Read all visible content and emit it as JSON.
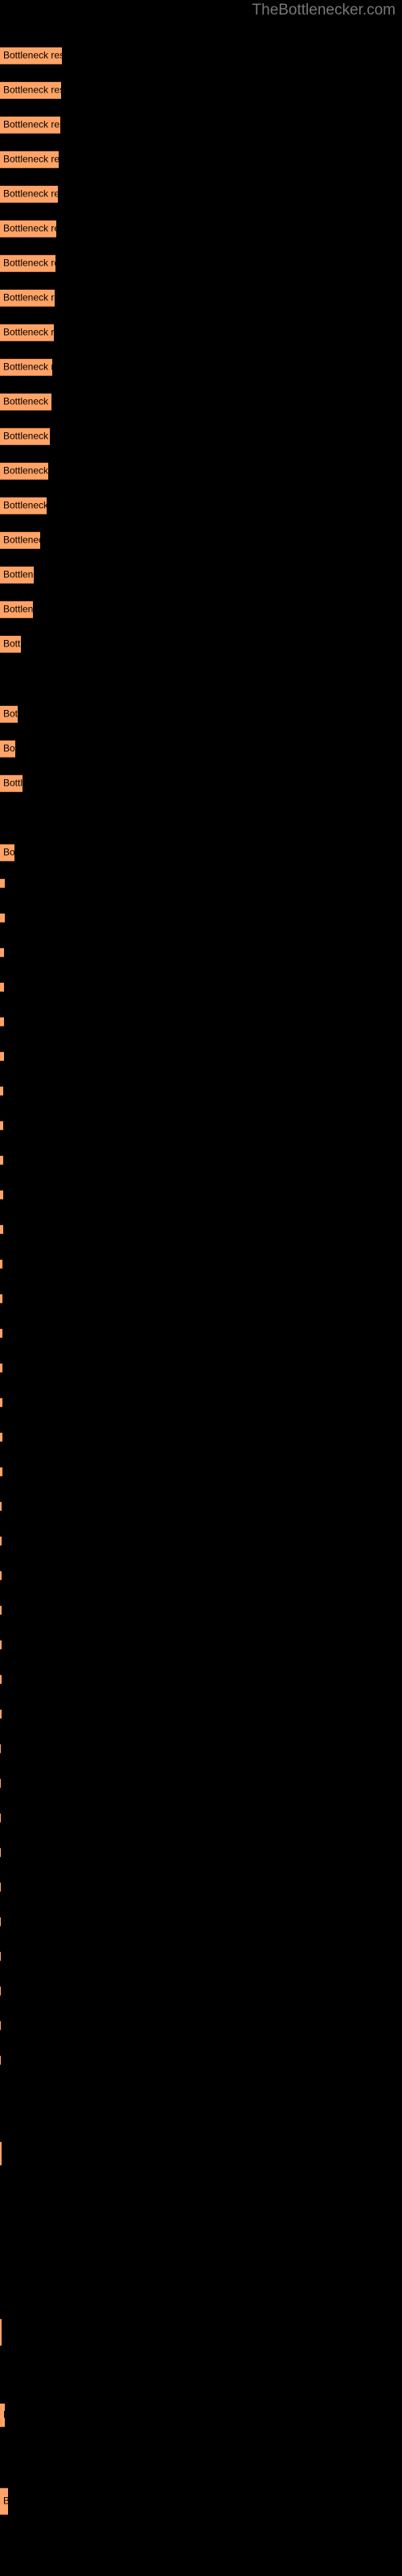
{
  "watermark": "TheBottlenecker.com",
  "theme": {
    "background": "#000000",
    "bar_color": "#ffa366",
    "bar_label_color": "#000000",
    "watermark_color": "#787878"
  },
  "chart_data": {
    "type": "bar",
    "orientation": "horizontal",
    "title": "",
    "subtitle": "",
    "xlabel": "",
    "ylabel": "",
    "grid": false,
    "legend": null,
    "axis_visible": false,
    "tick_labels_visible": false,
    "bar_label_text": "Bottleneck result",
    "xlim": [
      0,
      100
    ],
    "categories": [
      "bar-1",
      "bar-2",
      "bar-3",
      "bar-4",
      "bar-5",
      "bar-6",
      "bar-7",
      "bar-8",
      "bar-9",
      "bar-10",
      "bar-11",
      "bar-12",
      "bar-13",
      "bar-14",
      "bar-15",
      "bar-16",
      "bar-17",
      "bar-18",
      "bar-19",
      "bar-20",
      "bar-21",
      "bar-22",
      "bar-23",
      "bar-24",
      "bar-25",
      "bar-26",
      "bar-27",
      "bar-28",
      "bar-29",
      "bar-30",
      "bar-31",
      "bar-32",
      "bar-33",
      "bar-34",
      "bar-35",
      "bar-36",
      "bar-37",
      "bar-38",
      "bar-39",
      "bar-40",
      "bar-41",
      "bar-42",
      "bar-43",
      "bar-44",
      "bar-45",
      "bar-46",
      "bar-47",
      "bar-48",
      "bar-49",
      "bar-50",
      "bar-51",
      "bar-52",
      "bar-53",
      "bar-54",
      "bar-55",
      "bar-56",
      "bar-57",
      "bar-58",
      "bar-59",
      "bar-60",
      "bar-61",
      "bar-62",
      "bar-63",
      "bar-64",
      "bar-65",
      "bar-66",
      "bar-67",
      "bar-68",
      "bar-69",
      "bar-70",
      "bar-71",
      "bar-72",
      "bar-73"
    ],
    "values": [
      77,
      76,
      75,
      73,
      72,
      70,
      69,
      68,
      67,
      65,
      64,
      62,
      60,
      58,
      50,
      42,
      41,
      26,
      22,
      19,
      18,
      17,
      16,
      15,
      14,
      13,
      13,
      12,
      12,
      11,
      11,
      10,
      10,
      9,
      9,
      9,
      8,
      8,
      8,
      7,
      7,
      7,
      6,
      6,
      6,
      6,
      5,
      5,
      5,
      5,
      5,
      4,
      4,
      4,
      4,
      4,
      4,
      3,
      3,
      3,
      3,
      3,
      3,
      3,
      2,
      2,
      2,
      2,
      1,
      1,
      5,
      10,
      19
    ],
    "bars": [
      {
        "name": "bar-1",
        "y": 58,
        "height": 22,
        "width": 77,
        "label": "Bottleneck result"
      },
      {
        "name": "bar-2",
        "y": 101,
        "height": 22,
        "width": 76,
        "label": "Bottleneck result"
      },
      {
        "name": "bar-3",
        "y": 144,
        "height": 22,
        "width": 75,
        "label": "Bottleneck result"
      },
      {
        "name": "bar-4",
        "y": 187,
        "height": 22,
        "width": 73,
        "label": "Bottleneck result"
      },
      {
        "name": "bar-5",
        "y": 230,
        "height": 22,
        "width": 72,
        "label": "Bottleneck result"
      },
      {
        "name": "bar-6",
        "y": 273,
        "height": 22,
        "width": 70,
        "label": "Bottleneck result"
      },
      {
        "name": "bar-7",
        "y": 316,
        "height": 22,
        "width": 69,
        "label": "Bottleneck result"
      },
      {
        "name": "bar-8",
        "y": 359,
        "height": 22,
        "width": 68,
        "label": "Bottleneck result"
      },
      {
        "name": "bar-9",
        "y": 402,
        "height": 22,
        "width": 67,
        "label": "Bottleneck result"
      },
      {
        "name": "bar-10",
        "y": 445,
        "height": 22,
        "width": 65,
        "label": "Bottleneck result"
      },
      {
        "name": "bar-11",
        "y": 488,
        "height": 22,
        "width": 64,
        "label": "Bottleneck result"
      },
      {
        "name": "bar-12",
        "y": 531,
        "height": 22,
        "width": 62,
        "label": "Bottleneck result"
      },
      {
        "name": "bar-13",
        "y": 574,
        "height": 22,
        "width": 60,
        "label": "Bottleneck result"
      },
      {
        "name": "bar-14",
        "y": 617,
        "height": 22,
        "width": 58,
        "label": "Bottleneck result"
      },
      {
        "name": "bar-15",
        "y": 660,
        "height": 22,
        "width": 50,
        "label": "Bottleneck result"
      },
      {
        "name": "bar-16",
        "y": 703,
        "height": 22,
        "width": 42,
        "label": "Bottleneck result"
      },
      {
        "name": "bar-17",
        "y": 746,
        "height": 22,
        "width": 41,
        "label": "Bottleneck result"
      },
      {
        "name": "bar-18",
        "y": 789,
        "height": 22,
        "width": 26,
        "label": "Bottleneck result"
      },
      {
        "name": "bar-19",
        "y": 876,
        "height": 22,
        "width": 22,
        "label": "Bottleneck result"
      },
      {
        "name": "bar-20",
        "y": 919,
        "height": 22,
        "width": 19,
        "label": "Bottleneck result"
      },
      {
        "name": "bar-21",
        "y": 962,
        "height": 22,
        "width": 28,
        "label": "Bottleneck result"
      },
      {
        "name": "bar-22",
        "y": 1048,
        "height": 22,
        "width": 18,
        "label": "Bottleneck result"
      },
      {
        "name": "bar-23",
        "y": 1091,
        "height": 12,
        "width": 6,
        "label": ""
      },
      {
        "name": "bar-24",
        "y": 1134,
        "height": 12,
        "width": 6,
        "label": ""
      },
      {
        "name": "bar-25",
        "y": 1177,
        "height": 12,
        "width": 5,
        "label": ""
      },
      {
        "name": "bar-26",
        "y": 1220,
        "height": 12,
        "width": 5,
        "label": ""
      },
      {
        "name": "bar-27",
        "y": 1263,
        "height": 12,
        "width": 5,
        "label": ""
      },
      {
        "name": "bar-28",
        "y": 1306,
        "height": 12,
        "width": 5,
        "label": ""
      },
      {
        "name": "bar-29",
        "y": 1349,
        "height": 12,
        "width": 4,
        "label": ""
      },
      {
        "name": "bar-30",
        "y": 1392,
        "height": 12,
        "width": 4,
        "label": ""
      },
      {
        "name": "bar-31",
        "y": 1435,
        "height": 12,
        "width": 4,
        "label": ""
      },
      {
        "name": "bar-32",
        "y": 1478,
        "height": 12,
        "width": 4,
        "label": ""
      },
      {
        "name": "bar-33",
        "y": 1521,
        "height": 12,
        "width": 4,
        "label": ""
      },
      {
        "name": "bar-34",
        "y": 1564,
        "height": 12,
        "width": 3,
        "label": ""
      },
      {
        "name": "bar-35",
        "y": 1607,
        "height": 12,
        "width": 3,
        "label": ""
      },
      {
        "name": "bar-36",
        "y": 1650,
        "height": 12,
        "width": 3,
        "label": ""
      },
      {
        "name": "bar-37",
        "y": 1693,
        "height": 12,
        "width": 3,
        "label": ""
      },
      {
        "name": "bar-38",
        "y": 1736,
        "height": 12,
        "width": 3,
        "label": ""
      },
      {
        "name": "bar-39",
        "y": 1779,
        "height": 12,
        "width": 3,
        "label": ""
      },
      {
        "name": "bar-40",
        "y": 1822,
        "height": 12,
        "width": 3,
        "label": ""
      },
      {
        "name": "bar-41",
        "y": 1865,
        "height": 12,
        "width": 2,
        "label": ""
      },
      {
        "name": "bar-42",
        "y": 1908,
        "height": 12,
        "width": 2,
        "label": ""
      },
      {
        "name": "bar-43",
        "y": 1951,
        "height": 12,
        "width": 2,
        "label": ""
      },
      {
        "name": "bar-44",
        "y": 1994,
        "height": 12,
        "width": 2,
        "label": ""
      },
      {
        "name": "bar-45",
        "y": 2037,
        "height": 12,
        "width": 2,
        "label": ""
      },
      {
        "name": "bar-46",
        "y": 2080,
        "height": 12,
        "width": 2,
        "label": ""
      },
      {
        "name": "bar-47",
        "y": 2123,
        "height": 12,
        "width": 2,
        "label": ""
      },
      {
        "name": "bar-48",
        "y": 2166,
        "height": 12,
        "width": 1,
        "label": ""
      },
      {
        "name": "bar-49",
        "y": 2209,
        "height": 12,
        "width": 1,
        "label": ""
      },
      {
        "name": "bar-50",
        "y": 2252,
        "height": 12,
        "width": 1,
        "label": ""
      },
      {
        "name": "bar-51",
        "y": 2295,
        "height": 12,
        "width": 1,
        "label": ""
      },
      {
        "name": "bar-52",
        "y": 2338,
        "height": 12,
        "width": 1,
        "label": ""
      },
      {
        "name": "bar-53",
        "y": 2381,
        "height": 12,
        "width": 1,
        "label": ""
      },
      {
        "name": "bar-54",
        "y": 2424,
        "height": 12,
        "width": 1,
        "label": ""
      },
      {
        "name": "bar-55",
        "y": 2467,
        "height": 12,
        "width": 1,
        "label": ""
      },
      {
        "name": "bar-56",
        "y": 2510,
        "height": 12,
        "width": 1,
        "label": ""
      },
      {
        "name": "bar-57",
        "y": 2553,
        "height": 12,
        "width": 1,
        "label": ""
      },
      {
        "name": "bar-58",
        "y": 2660,
        "height": 30,
        "width": 2,
        "label": ""
      },
      {
        "name": "bar-59",
        "y": 2880,
        "height": 34,
        "width": 2,
        "label": ""
      },
      {
        "name": "bar-60",
        "y": 2985,
        "height": 30,
        "width": 6,
        "label": "B"
      },
      {
        "name": "bar-61",
        "y": 3090,
        "height": 34,
        "width": 10,
        "label": "B"
      }
    ]
  }
}
